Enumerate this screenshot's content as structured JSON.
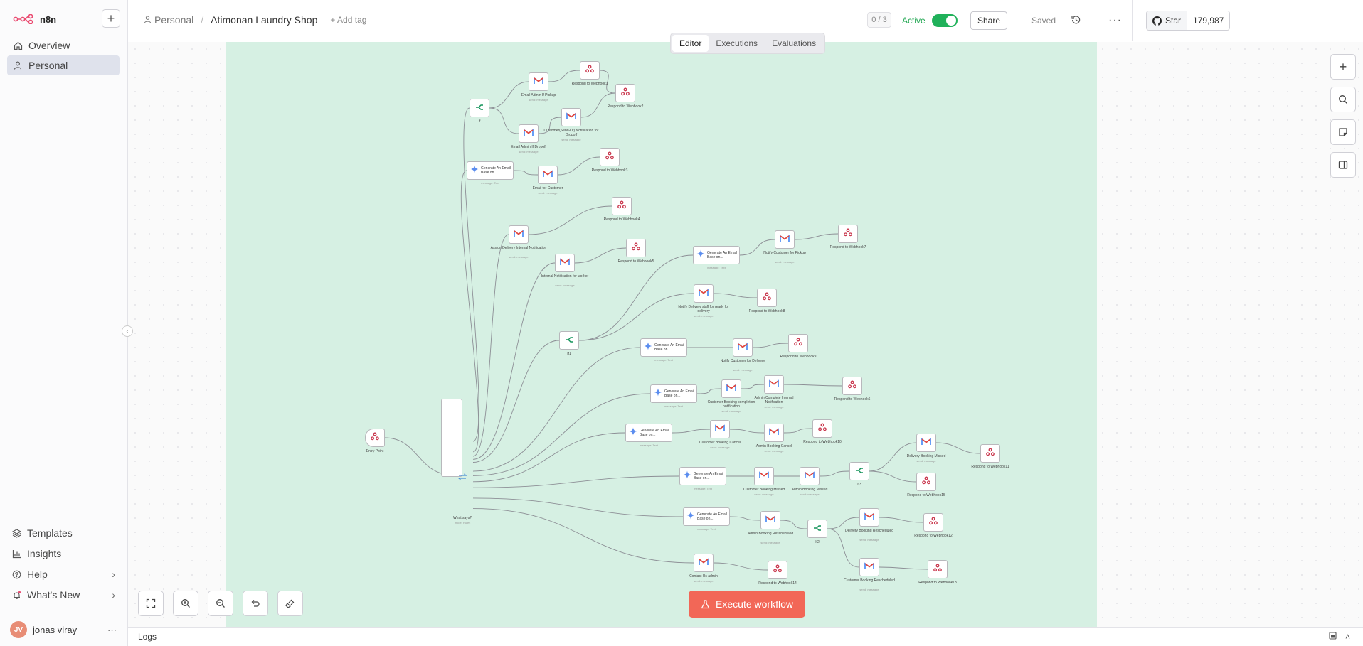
{
  "app": {
    "name": "n8n"
  },
  "sidebar": {
    "items": [
      {
        "label": "Overview"
      },
      {
        "label": "Personal"
      }
    ],
    "bottom": [
      {
        "label": "Templates"
      },
      {
        "label": "Insights"
      },
      {
        "label": "Help"
      },
      {
        "label": "What's New"
      }
    ],
    "user": {
      "initials": "JV",
      "name": "jonas viray"
    }
  },
  "header": {
    "project": "Personal",
    "workflow_name": "Atimonan Laundry Shop",
    "add_tag": "+ Add tag",
    "counter": "0 / 3",
    "active_label": "Active",
    "share_label": "Share",
    "saved_label": "Saved",
    "github": {
      "star_label": "Star",
      "count": "179,987"
    }
  },
  "tabs": [
    "Editor",
    "Executions",
    "Evaluations"
  ],
  "execute_label": "Execute workflow",
  "logs_label": "Logs",
  "colors": {
    "accent": "#f26757",
    "canvas_tint": "#d6f0e3",
    "active": "#20b15a"
  },
  "workflow": {
    "nodes": [
      {
        "label": "Entry Point",
        "sub": ""
      },
      {
        "label": "What says?",
        "sub": "mode: Rules"
      },
      {
        "label": "If",
        "sub": ""
      },
      {
        "label": "Email Admin If Pickup",
        "sub": "send: message"
      },
      {
        "label": "Respond to Webhook1",
        "sub": ""
      },
      {
        "label": "Respond to Webhook2",
        "sub": ""
      },
      {
        "label": "Customer(Send-Of) Notification for Dropoff",
        "sub": "send: message"
      },
      {
        "label": "Email Admin If Dropoff",
        "sub": "send: message"
      },
      {
        "label": "Generate An Email Base on...",
        "sub": "message: Text"
      },
      {
        "label": "Email for Customer",
        "sub": "send: message"
      },
      {
        "label": "Respond to Webhook3",
        "sub": ""
      },
      {
        "label": "Respond to Webhook4",
        "sub": ""
      },
      {
        "label": "Assign Delivery Internal Notification",
        "sub": "send: message"
      },
      {
        "label": "Respond to Webhook5",
        "sub": ""
      },
      {
        "label": "Internal Notification for worker",
        "sub": "send: message"
      },
      {
        "label": "Generate An Email Base on...",
        "sub": "message: Text"
      },
      {
        "label": "Notify Customer for Pickup",
        "sub": "send: message"
      },
      {
        "label": "Respond to Webhook7",
        "sub": ""
      },
      {
        "label": "Notify Delivery staff for ready for delivery",
        "sub": "send: message"
      },
      {
        "label": "Respond to Webhook8",
        "sub": ""
      },
      {
        "label": "If1",
        "sub": ""
      },
      {
        "label": "Generate An Email Base on...",
        "sub": "message: Text"
      },
      {
        "label": "Notify Customer for Delivery",
        "sub": "send: message"
      },
      {
        "label": "Respond to Webhook9",
        "sub": ""
      },
      {
        "label": "Generate An Email Base on...",
        "sub": "message: Text"
      },
      {
        "label": "Customer Booking completion notification",
        "sub": "send: message"
      },
      {
        "label": "Admin Complete Internal Notification",
        "sub": "send: message"
      },
      {
        "label": "Respond to Webhook6",
        "sub": ""
      },
      {
        "label": "Generate An Email Base on...",
        "sub": "message: Text"
      },
      {
        "label": "Customer Booking Cancel",
        "sub": "send: message"
      },
      {
        "label": "Admin Booking Cancel",
        "sub": "send: message"
      },
      {
        "label": "Respond to Webhook10",
        "sub": ""
      },
      {
        "label": "Delivery Booking Missed",
        "sub": "send: message"
      },
      {
        "label": "Respond to Webhook11",
        "sub": ""
      },
      {
        "label": "Generate An Email Base on...",
        "sub": "message: Text"
      },
      {
        "label": "Customer Booking Missed",
        "sub": "send: message"
      },
      {
        "label": "Admin Booking Missed",
        "sub": "send: message"
      },
      {
        "label": "If3",
        "sub": ""
      },
      {
        "label": "Respond to Webhook15",
        "sub": ""
      },
      {
        "label": "Generate An Email Base on...",
        "sub": "message: Text"
      },
      {
        "label": "Admin Booking Rescheduled",
        "sub": "send: message"
      },
      {
        "label": "If2",
        "sub": ""
      },
      {
        "label": "Delivery Booking Rescheduled",
        "sub": "send: message"
      },
      {
        "label": "Respond to Webhook12",
        "sub": ""
      },
      {
        "label": "Customer Booking Rescheduled",
        "sub": "send: message"
      },
      {
        "label": "Respond to Webhook13",
        "sub": ""
      },
      {
        "label": "Contact Us admin",
        "sub": "send: message"
      },
      {
        "label": "Respond to Webhook14",
        "sub": ""
      }
    ]
  }
}
